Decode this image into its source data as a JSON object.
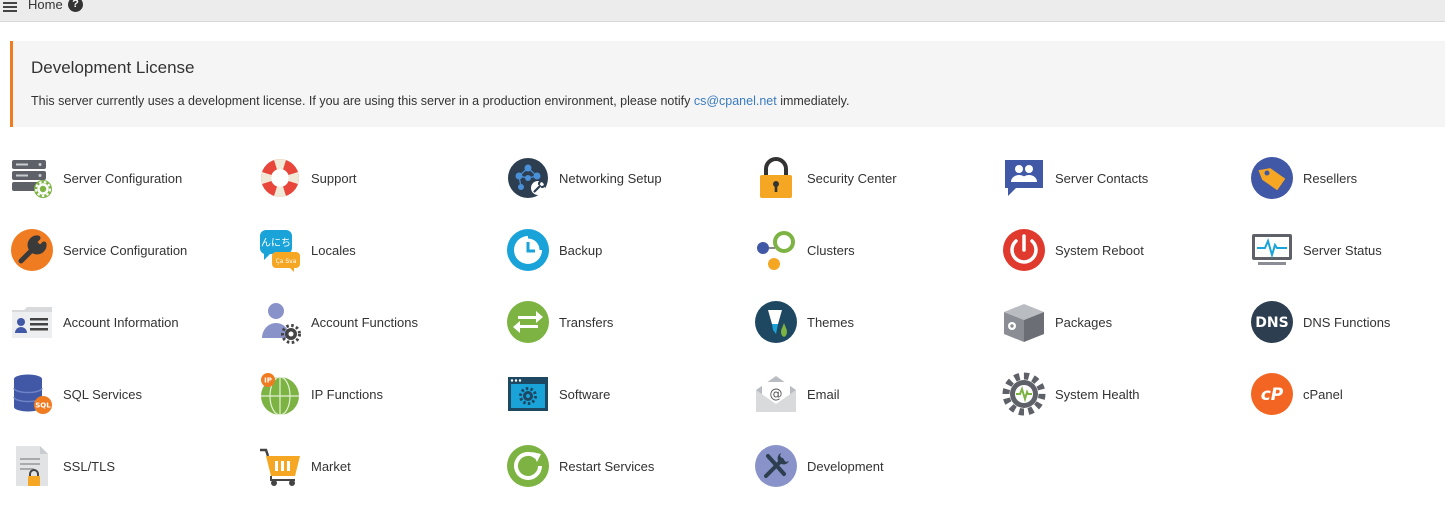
{
  "topbar": {
    "breadcrumb": "Home",
    "help_glyph": "?",
    "menu_icon": "hamburger-icon"
  },
  "notice": {
    "title": "Development License",
    "message_before": "This server currently uses a development license. If you are using this server in a production environment, please notify ",
    "email": "cs@cpanel.net",
    "message_after": " immediately.",
    "accent_color": "#f07c22"
  },
  "groups": [
    {
      "label": "Server Configuration",
      "icon": "server-configuration-icon"
    },
    {
      "label": "Support",
      "icon": "support-lifebuoy-icon"
    },
    {
      "label": "Networking Setup",
      "icon": "networking-setup-icon"
    },
    {
      "label": "Security Center",
      "icon": "padlock-icon"
    },
    {
      "label": "Server Contacts",
      "icon": "contacts-icon"
    },
    {
      "label": "Resellers",
      "icon": "tag-icon"
    },
    {
      "label": "Service Configuration",
      "icon": "wrench-icon"
    },
    {
      "label": "Locales",
      "icon": "speech-bubbles-icon"
    },
    {
      "label": "Backup",
      "icon": "backup-clock-icon"
    },
    {
      "label": "Clusters",
      "icon": "clusters-icon"
    },
    {
      "label": "System Reboot",
      "icon": "power-icon"
    },
    {
      "label": "Server Status",
      "icon": "monitor-pulse-icon"
    },
    {
      "label": "Account Information",
      "icon": "id-card-icon"
    },
    {
      "label": "Account Functions",
      "icon": "user-gear-icon"
    },
    {
      "label": "Transfers",
      "icon": "transfer-arrows-icon"
    },
    {
      "label": "Themes",
      "icon": "paint-brush-icon"
    },
    {
      "label": "Packages",
      "icon": "package-box-icon"
    },
    {
      "label": "DNS Functions",
      "icon": "dns-icon"
    },
    {
      "label": "SQL Services",
      "icon": "database-icon"
    },
    {
      "label": "IP Functions",
      "icon": "globe-ip-icon"
    },
    {
      "label": "Software",
      "icon": "software-window-icon"
    },
    {
      "label": "Email",
      "icon": "envelope-icon"
    },
    {
      "label": "System Health",
      "icon": "gear-pulse-icon"
    },
    {
      "label": "cPanel",
      "icon": "cpanel-logo-icon"
    },
    {
      "label": "SSL/TLS",
      "icon": "certificate-lock-icon"
    },
    {
      "label": "Market",
      "icon": "shopping-cart-icon"
    },
    {
      "label": "Restart Services",
      "icon": "restart-icon"
    },
    {
      "label": "Development",
      "icon": "development-tools-icon"
    }
  ]
}
